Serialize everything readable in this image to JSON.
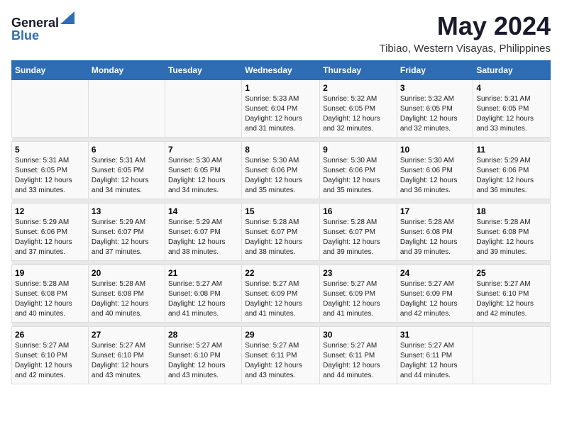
{
  "logo": {
    "line1": "General",
    "line2": "Blue"
  },
  "title": "May 2024",
  "subtitle": "Tibiao, Western Visayas, Philippines",
  "weekdays": [
    "Sunday",
    "Monday",
    "Tuesday",
    "Wednesday",
    "Thursday",
    "Friday",
    "Saturday"
  ],
  "weeks": [
    {
      "days": [
        {
          "num": "",
          "info": ""
        },
        {
          "num": "",
          "info": ""
        },
        {
          "num": "",
          "info": ""
        },
        {
          "num": "1",
          "info": "Sunrise: 5:33 AM\nSunset: 6:04 PM\nDaylight: 12 hours\nand 31 minutes."
        },
        {
          "num": "2",
          "info": "Sunrise: 5:32 AM\nSunset: 6:05 PM\nDaylight: 12 hours\nand 32 minutes."
        },
        {
          "num": "3",
          "info": "Sunrise: 5:32 AM\nSunset: 6:05 PM\nDaylight: 12 hours\nand 32 minutes."
        },
        {
          "num": "4",
          "info": "Sunrise: 5:31 AM\nSunset: 6:05 PM\nDaylight: 12 hours\nand 33 minutes."
        }
      ]
    },
    {
      "days": [
        {
          "num": "5",
          "info": "Sunrise: 5:31 AM\nSunset: 6:05 PM\nDaylight: 12 hours\nand 33 minutes."
        },
        {
          "num": "6",
          "info": "Sunrise: 5:31 AM\nSunset: 6:05 PM\nDaylight: 12 hours\nand 34 minutes."
        },
        {
          "num": "7",
          "info": "Sunrise: 5:30 AM\nSunset: 6:05 PM\nDaylight: 12 hours\nand 34 minutes."
        },
        {
          "num": "8",
          "info": "Sunrise: 5:30 AM\nSunset: 6:06 PM\nDaylight: 12 hours\nand 35 minutes."
        },
        {
          "num": "9",
          "info": "Sunrise: 5:30 AM\nSunset: 6:06 PM\nDaylight: 12 hours\nand 35 minutes."
        },
        {
          "num": "10",
          "info": "Sunrise: 5:30 AM\nSunset: 6:06 PM\nDaylight: 12 hours\nand 36 minutes."
        },
        {
          "num": "11",
          "info": "Sunrise: 5:29 AM\nSunset: 6:06 PM\nDaylight: 12 hours\nand 36 minutes."
        }
      ]
    },
    {
      "days": [
        {
          "num": "12",
          "info": "Sunrise: 5:29 AM\nSunset: 6:06 PM\nDaylight: 12 hours\nand 37 minutes."
        },
        {
          "num": "13",
          "info": "Sunrise: 5:29 AM\nSunset: 6:07 PM\nDaylight: 12 hours\nand 37 minutes."
        },
        {
          "num": "14",
          "info": "Sunrise: 5:29 AM\nSunset: 6:07 PM\nDaylight: 12 hours\nand 38 minutes."
        },
        {
          "num": "15",
          "info": "Sunrise: 5:28 AM\nSunset: 6:07 PM\nDaylight: 12 hours\nand 38 minutes."
        },
        {
          "num": "16",
          "info": "Sunrise: 5:28 AM\nSunset: 6:07 PM\nDaylight: 12 hours\nand 39 minutes."
        },
        {
          "num": "17",
          "info": "Sunrise: 5:28 AM\nSunset: 6:08 PM\nDaylight: 12 hours\nand 39 minutes."
        },
        {
          "num": "18",
          "info": "Sunrise: 5:28 AM\nSunset: 6:08 PM\nDaylight: 12 hours\nand 39 minutes."
        }
      ]
    },
    {
      "days": [
        {
          "num": "19",
          "info": "Sunrise: 5:28 AM\nSunset: 6:08 PM\nDaylight: 12 hours\nand 40 minutes."
        },
        {
          "num": "20",
          "info": "Sunrise: 5:28 AM\nSunset: 6:08 PM\nDaylight: 12 hours\nand 40 minutes."
        },
        {
          "num": "21",
          "info": "Sunrise: 5:27 AM\nSunset: 6:08 PM\nDaylight: 12 hours\nand 41 minutes."
        },
        {
          "num": "22",
          "info": "Sunrise: 5:27 AM\nSunset: 6:09 PM\nDaylight: 12 hours\nand 41 minutes."
        },
        {
          "num": "23",
          "info": "Sunrise: 5:27 AM\nSunset: 6:09 PM\nDaylight: 12 hours\nand 41 minutes."
        },
        {
          "num": "24",
          "info": "Sunrise: 5:27 AM\nSunset: 6:09 PM\nDaylight: 12 hours\nand 42 minutes."
        },
        {
          "num": "25",
          "info": "Sunrise: 5:27 AM\nSunset: 6:10 PM\nDaylight: 12 hours\nand 42 minutes."
        }
      ]
    },
    {
      "days": [
        {
          "num": "26",
          "info": "Sunrise: 5:27 AM\nSunset: 6:10 PM\nDaylight: 12 hours\nand 42 minutes."
        },
        {
          "num": "27",
          "info": "Sunrise: 5:27 AM\nSunset: 6:10 PM\nDaylight: 12 hours\nand 43 minutes."
        },
        {
          "num": "28",
          "info": "Sunrise: 5:27 AM\nSunset: 6:10 PM\nDaylight: 12 hours\nand 43 minutes."
        },
        {
          "num": "29",
          "info": "Sunrise: 5:27 AM\nSunset: 6:11 PM\nDaylight: 12 hours\nand 43 minutes."
        },
        {
          "num": "30",
          "info": "Sunrise: 5:27 AM\nSunset: 6:11 PM\nDaylight: 12 hours\nand 44 minutes."
        },
        {
          "num": "31",
          "info": "Sunrise: 5:27 AM\nSunset: 6:11 PM\nDaylight: 12 hours\nand 44 minutes."
        },
        {
          "num": "",
          "info": ""
        }
      ]
    }
  ]
}
